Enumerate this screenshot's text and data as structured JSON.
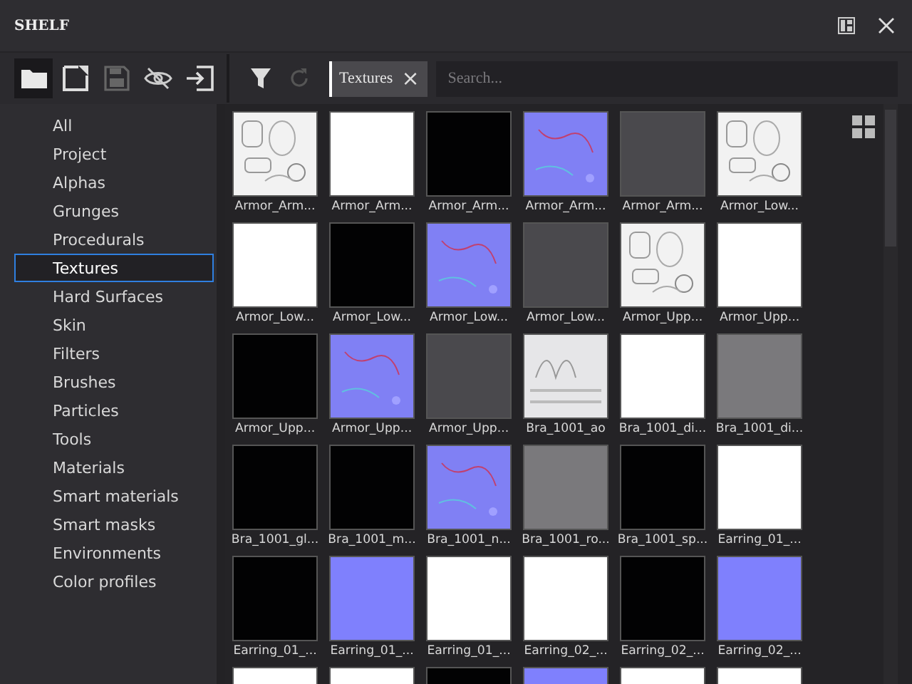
{
  "window": {
    "title": "SHELF"
  },
  "toolbar": {
    "filter_chip": {
      "label": "Textures",
      "close": "×"
    },
    "search": {
      "placeholder": "Search..."
    }
  },
  "sidebar": {
    "items": [
      {
        "label": "All",
        "selected": false
      },
      {
        "label": "Project",
        "selected": false
      },
      {
        "label": "Alphas",
        "selected": false
      },
      {
        "label": "Grunges",
        "selected": false
      },
      {
        "label": "Procedurals",
        "selected": false
      },
      {
        "label": "Textures",
        "selected": true
      },
      {
        "label": "Hard Surfaces",
        "selected": false
      },
      {
        "label": "Skin",
        "selected": false
      },
      {
        "label": "Filters",
        "selected": false
      },
      {
        "label": "Brushes",
        "selected": false
      },
      {
        "label": "Particles",
        "selected": false
      },
      {
        "label": "Tools",
        "selected": false
      },
      {
        "label": "Materials",
        "selected": false
      },
      {
        "label": "Smart materials",
        "selected": false
      },
      {
        "label": "Smart masks",
        "selected": false
      },
      {
        "label": "Environments",
        "selected": false
      },
      {
        "label": "Color profiles",
        "selected": false
      }
    ]
  },
  "assets": [
    {
      "label": "Armor_Arm...",
      "kind": "sheet"
    },
    {
      "label": "Armor_Arm...",
      "kind": "white"
    },
    {
      "label": "Armor_Arm...",
      "kind": "black"
    },
    {
      "label": "Armor_Arm...",
      "kind": "normal"
    },
    {
      "label": "Armor_Arm...",
      "kind": "gray"
    },
    {
      "label": "Armor_Low...",
      "kind": "sheet"
    },
    {
      "label": "Armor_Low...",
      "kind": "white"
    },
    {
      "label": "Armor_Low...",
      "kind": "black"
    },
    {
      "label": "Armor_Low...",
      "kind": "normal"
    },
    {
      "label": "Armor_Low...",
      "kind": "gray"
    },
    {
      "label": "Armor_Upp...",
      "kind": "sheet"
    },
    {
      "label": "Armor_Upp...",
      "kind": "white"
    },
    {
      "label": "Armor_Upp...",
      "kind": "black"
    },
    {
      "label": "Armor_Upp...",
      "kind": "normal"
    },
    {
      "label": "Armor_Upp...",
      "kind": "gray"
    },
    {
      "label": "Bra_1001_ao",
      "kind": "lines"
    },
    {
      "label": "Bra_1001_di...",
      "kind": "white"
    },
    {
      "label": "Bra_1001_di...",
      "kind": "midgray"
    },
    {
      "label": "Bra_1001_gl...",
      "kind": "black"
    },
    {
      "label": "Bra_1001_m...",
      "kind": "black"
    },
    {
      "label": "Bra_1001_n...",
      "kind": "normal"
    },
    {
      "label": "Bra_1001_ro...",
      "kind": "midgray"
    },
    {
      "label": "Bra_1001_sp...",
      "kind": "black"
    },
    {
      "label": "Earring_01_...",
      "kind": "white"
    },
    {
      "label": "Earring_01_...",
      "kind": "black"
    },
    {
      "label": "Earring_01_...",
      "kind": "blue"
    },
    {
      "label": "Earring_01_...",
      "kind": "white"
    },
    {
      "label": "Earring_02_...",
      "kind": "white"
    },
    {
      "label": "Earring_02_...",
      "kind": "black"
    },
    {
      "label": "Earring_02_...",
      "kind": "blue"
    },
    {
      "kind": "white"
    },
    {
      "kind": "white"
    },
    {
      "kind": "black"
    },
    {
      "kind": "blue"
    },
    {
      "kind": "white"
    },
    {
      "kind": "white"
    }
  ]
}
